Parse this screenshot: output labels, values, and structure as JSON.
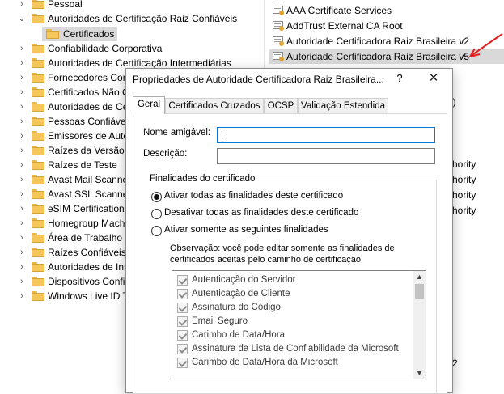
{
  "tree": {
    "items": [
      {
        "label": "Pessoal",
        "has_chevron": true,
        "indent": 0
      },
      {
        "label": "Autoridades de Certificação Raiz Confiáveis",
        "has_chevron": false,
        "expanded": true,
        "indent": 0
      },
      {
        "label": "Certificados",
        "has_chevron": false,
        "indent": 1,
        "selected": true
      },
      {
        "label": "Confiabilidade Corporativa",
        "has_chevron": true,
        "indent": 0
      },
      {
        "label": "Autoridades de Certificação Intermediárias",
        "has_chevron": true,
        "indent": 0
      },
      {
        "label": "Fornecedores Con",
        "has_chevron": true,
        "indent": 0
      },
      {
        "label": "Certificados Não C",
        "has_chevron": true,
        "indent": 0
      },
      {
        "label": "Autoridades de Ce",
        "has_chevron": true,
        "indent": 0
      },
      {
        "label": "Pessoas Confiávei",
        "has_chevron": true,
        "indent": 0
      },
      {
        "label": "Emissores de Aute",
        "has_chevron": true,
        "indent": 0
      },
      {
        "label": "Raízes da Versão P",
        "has_chevron": true,
        "indent": 0
      },
      {
        "label": "Raízes de Teste",
        "has_chevron": true,
        "indent": 0
      },
      {
        "label": "Avast Mail Scanne",
        "has_chevron": true,
        "indent": 0
      },
      {
        "label": "Avast SSL Scanner",
        "has_chevron": true,
        "indent": 0
      },
      {
        "label": "eSIM Certification",
        "has_chevron": true,
        "indent": 0
      },
      {
        "label": "Homegroup Mach",
        "has_chevron": true,
        "indent": 0
      },
      {
        "label": "Área de Trabalho R",
        "has_chevron": true,
        "indent": 0
      },
      {
        "label": "Raízes Confiáveis d",
        "has_chevron": true,
        "indent": 0
      },
      {
        "label": "Autoridades de Ins",
        "has_chevron": true,
        "indent": 0
      },
      {
        "label": "Dispositivos Confi",
        "has_chevron": true,
        "indent": 0
      },
      {
        "label": "Windows Live ID T",
        "has_chevron": true,
        "indent": 0
      }
    ]
  },
  "cert_list": {
    "items": [
      {
        "label": "AAA Certificate Services",
        "selected": false
      },
      {
        "label": "AddTrust External CA Root",
        "selected": false
      },
      {
        "label": "Autoridade Certificadora Raiz Brasileira v2",
        "selected": false
      },
      {
        "label": "Autoridade Certificadora Raiz Brasileira v5",
        "selected": true
      }
    ],
    "right_fragments": {
      "paren": "l)",
      "hority": "hority",
      "num": "2"
    }
  },
  "dialog": {
    "title": "Propriedades de Autoridade Certificadora Raiz Brasileira...",
    "help": "?",
    "close": "✕",
    "tabs": [
      "Geral",
      "Certificados Cruzados",
      "OCSP",
      "Validação Estendida"
    ],
    "active_tab": "Geral",
    "friendly_name_label": "Nome amigável:",
    "friendly_name_value": "",
    "description_label": "Descrição:",
    "description_value": "",
    "purposes_group": "Finalidades do certificado",
    "radios": [
      {
        "label": "Ativar todas as finalidades deste certificado",
        "checked": true
      },
      {
        "label": "Desativar todas as finalidades deste certificado",
        "checked": false
      },
      {
        "label": "Ativar somente as seguintes finalidades",
        "checked": false
      }
    ],
    "note": "Observação: você pode editar somente as finalidades de certificados aceitas pelo caminho de certificação.",
    "purposes": [
      "Autenticação do Servidor",
      "Autenticação de Cliente",
      "Assinatura do Código",
      "Email Seguro",
      "Carimbo de Data/Hora",
      "Assinatura da Lista de Confiabilidade da Microsoft",
      "Carimbo de Data/Hora da Microsoft"
    ]
  },
  "colors": {
    "annotation_arrow": "#e02020",
    "selection": "#d9d9d9",
    "focus_border": "#0078d7"
  }
}
